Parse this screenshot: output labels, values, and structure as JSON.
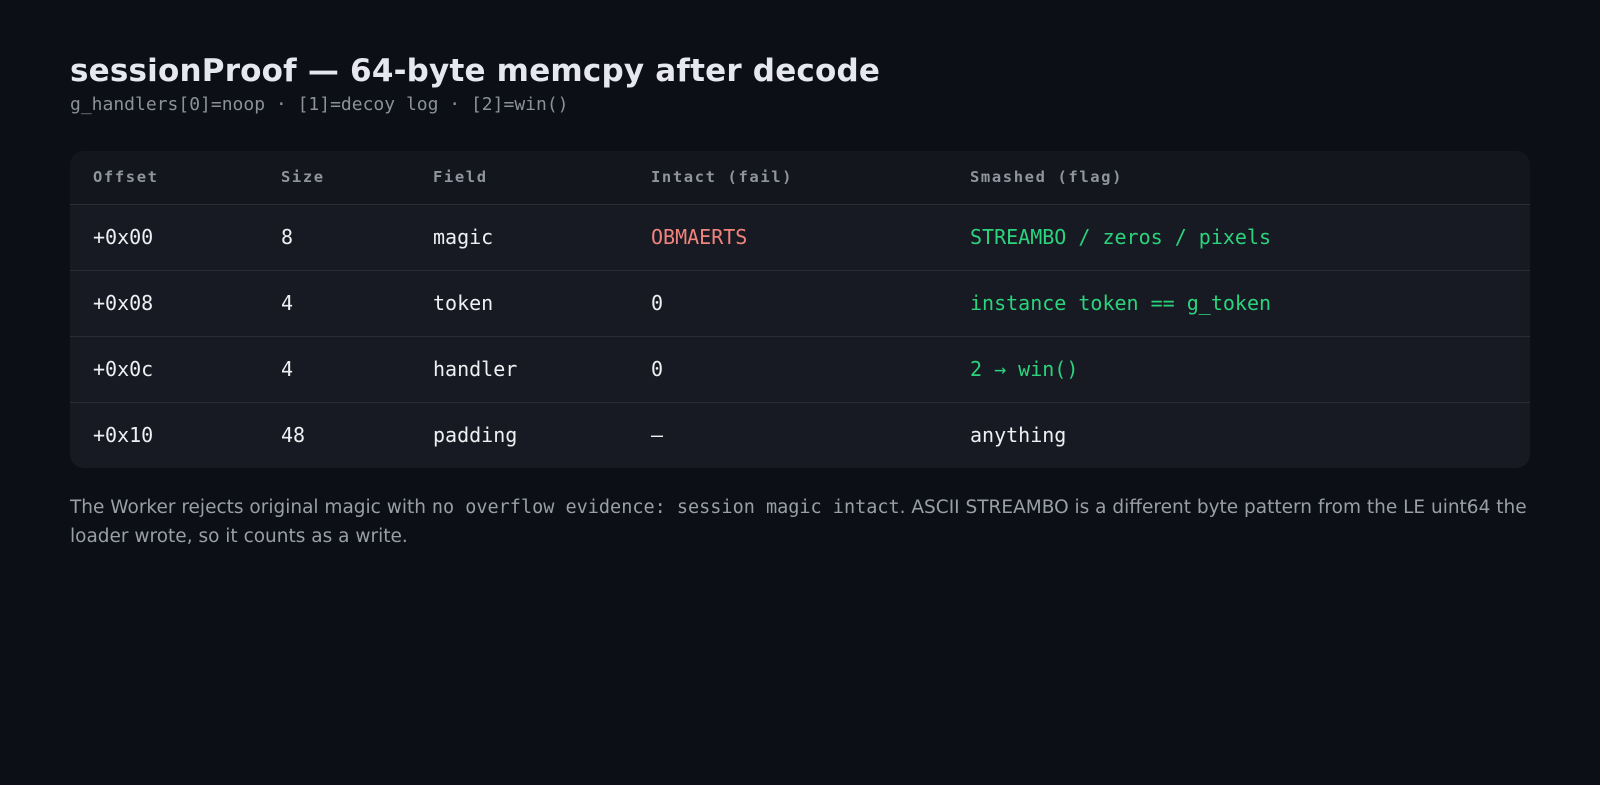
{
  "header": {
    "title": "sessionProof — 64-byte memcpy after decode",
    "subtitle": "g_handlers[0]=noop · [1]=decoy log · [2]=win()"
  },
  "table": {
    "columns": [
      "Offset",
      "Size",
      "Field",
      "Intact (fail)",
      "Smashed (flag)"
    ],
    "rows": [
      {
        "offset": "+0x00",
        "size": "8",
        "field": "magic",
        "intact": "OBMAERTS",
        "smashed": "STREAMBO / zeros / pixels"
      },
      {
        "offset": "+0x08",
        "size": "4",
        "field": "token",
        "intact": "0",
        "smashed": "instance token == g_token"
      },
      {
        "offset": "+0x0c",
        "size": "4",
        "field": "handler",
        "intact": "0",
        "smashed": "2 → win()"
      },
      {
        "offset": "+0x10",
        "size": "48",
        "field": "padding",
        "intact": "—",
        "smashed": "anything"
      }
    ]
  },
  "footnote": {
    "before": "The Worker rejects original magic with ",
    "code": "no overflow evidence: session magic intact",
    "after": ". ASCII STREAMBO is a different byte pattern from the LE uint64 the loader wrote, so it counts as a write."
  },
  "colors": {
    "background": "#0c0f15",
    "fail": "#f0837c",
    "flag": "#2ad37c"
  }
}
